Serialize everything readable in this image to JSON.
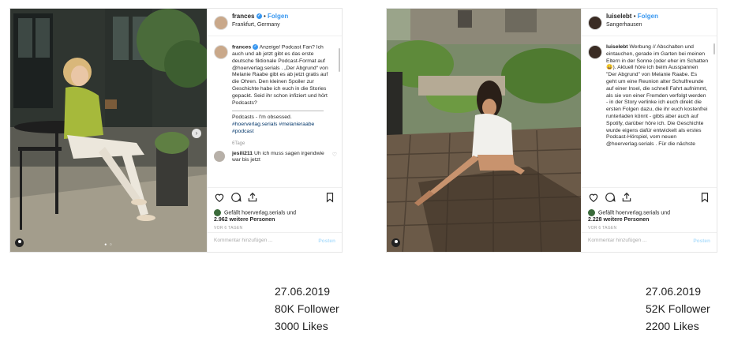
{
  "posts": [
    {
      "username": "frances",
      "follow_label": "Folgen",
      "location": "Frankfurt, Germany",
      "caption_user": "frances",
      "caption_text": "Anzeige/ Podcast Fan? Ich auch und ab jetzt gibt es das erste deutsche fiktionale Podcast-Format auf @hoerverlag.serials . „Der Abgrund“ von Melanie Raabe gibt es ab jetzt gratis auf die Ohren. Den kleinen Spoiler zur Geschichte habe ich euch in die Stories gepackt. Seid ihr schon infiziert und hört Podcasts?",
      "caption_extra": "Podcasts - I'm obsessed.",
      "caption_tags": "#hoerverlag.serials #melanieraabe #podcast",
      "time": "6Tage",
      "comment_user": "jesili211",
      "comment_text": "Uh ich muss sagen irgendwie war bis jetzt",
      "liked_by": "Gefällt hoerverlag.serials und",
      "liked_count": "2.962 weitere Personen",
      "time_ago": "VOR 6 TAGEN",
      "comment_placeholder": "Kommentar hinzufügen ...",
      "post_label": "Posten"
    },
    {
      "username": "luiselebt",
      "follow_label": "Folgen",
      "location": "Sangerhausen",
      "caption_user": "luiselebt",
      "caption_text": "Werbung // Abschalten und eintauchen, gerade im Garten bei meinen Eltern in der Sonne (oder eher im Schatten 😄). Aktuell höre ich beim Ausspannen \"Der Abgrund\" von Melanie Raabe. Es geht um eine Reunion alter Schulfreunde auf einer Insel, die schnell Fahrt aufnimmt, als sie von einer Fremden verfolgt werden - in der Story verlinke ich euch direkt die ersten Folgen dazu, die ihr euch kostenfrei runterladen könnt - gibts aber auch auf Spotify, darüber höre ich. Die Geschichte wurde eigens dafür entwickelt als erstes Podcast-Hörspiel, vom neuen @hoerverlag.serials . Für die nächste",
      "liked_by": "Gefällt hoerverlag.serials und",
      "liked_count": "2.228 weitere Personen",
      "time_ago": "VOR 6 TAGEN",
      "comment_placeholder": "Kommentar hinzufügen ...",
      "post_label": "Posten"
    }
  ],
  "stats": [
    {
      "date": "27.06.2019",
      "followers": "80K Follower",
      "likes": "3000 Likes"
    },
    {
      "date": "27.06.2019",
      "followers": "52K Follower",
      "likes": "2200 Likes"
    }
  ],
  "icons": {
    "like": "heart-icon",
    "comment": "comment-icon",
    "share": "share-icon",
    "save": "bookmark-icon",
    "user_tag": "user-tag-icon",
    "next": "chevron-right-icon",
    "verified": "verified-badge-icon"
  },
  "colors": {
    "link_blue": "#3897f0",
    "tag_navy": "#003569",
    "post_button": "#b2dffc"
  }
}
